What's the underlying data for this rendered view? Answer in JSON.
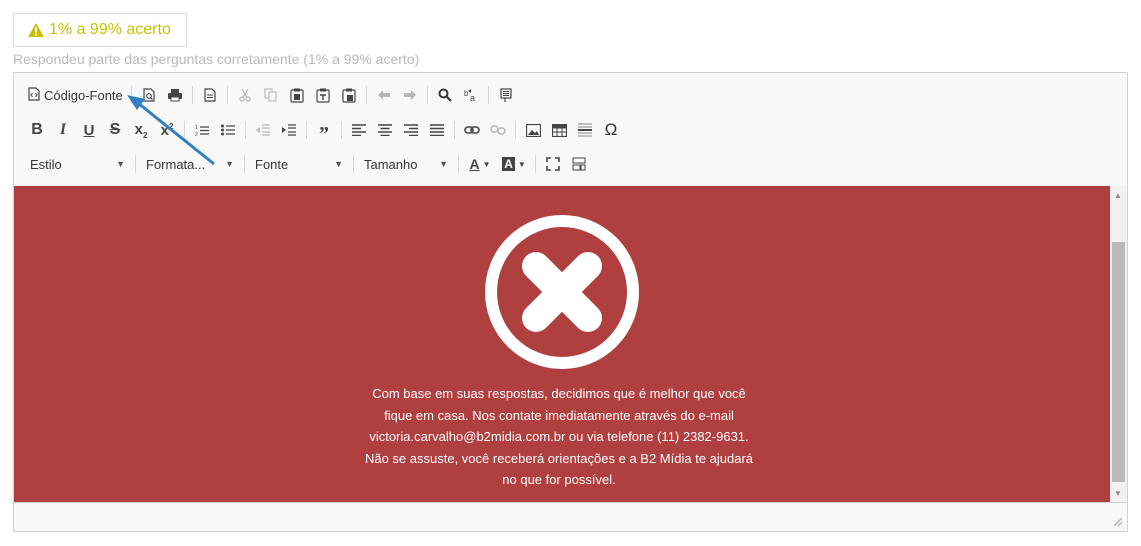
{
  "result_badge": {
    "text": "1% a 99% acerto",
    "color": "#c9c000",
    "icon": "warning-icon"
  },
  "subtitle": "Respondeu parte das perguntas corretamente (1% a 99% acerto)",
  "toolbar": {
    "source_label": "Código-Fonte",
    "combos": {
      "style": "Estilo",
      "format": "Formata...",
      "font": "Fonte",
      "size": "Tamanho"
    }
  },
  "content": {
    "background": "#b03f40",
    "icon": "x-circle-icon",
    "message_lines": [
      "Com base em suas respostas, decidimos que é melhor que você",
      "fique em casa. Nos contate imediatamente através do e-mail",
      "victoria.carvalho@b2midia.com.br ou via telefone (11) 2382-9631.",
      "Não se assuste, você receberá orientações e a B2 Mídia te ajudará",
      "no que for possível."
    ]
  },
  "annotation": {
    "icon": "arrow-pointer-icon",
    "color": "#2f7fc1"
  }
}
